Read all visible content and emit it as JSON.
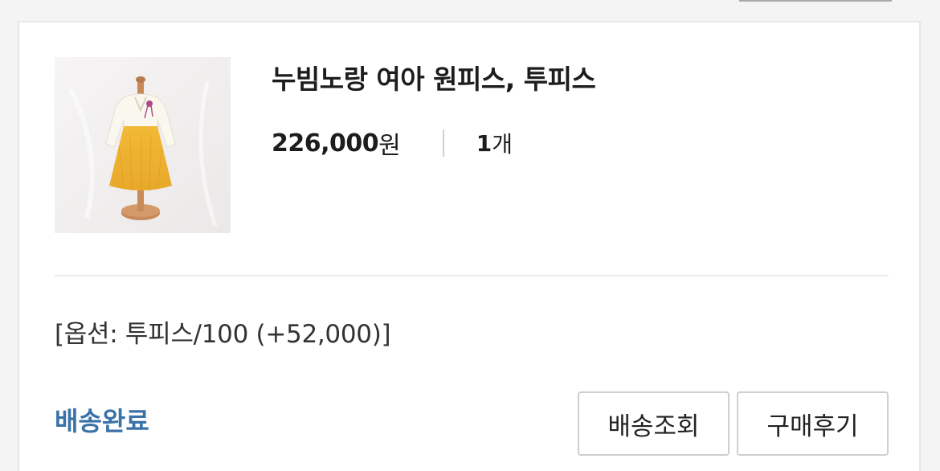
{
  "product": {
    "title": "누빔노랑 여아 원피스, 투피스",
    "price": "226,000",
    "price_unit": "원",
    "quantity": "1",
    "quantity_unit": "개",
    "option": "[옵션: 투피스/100 (+52,000)]"
  },
  "order": {
    "status": "배송완료",
    "status_color": "#3a72a8"
  },
  "actions": {
    "track_label": "배송조회",
    "review_label": "구매후기"
  }
}
